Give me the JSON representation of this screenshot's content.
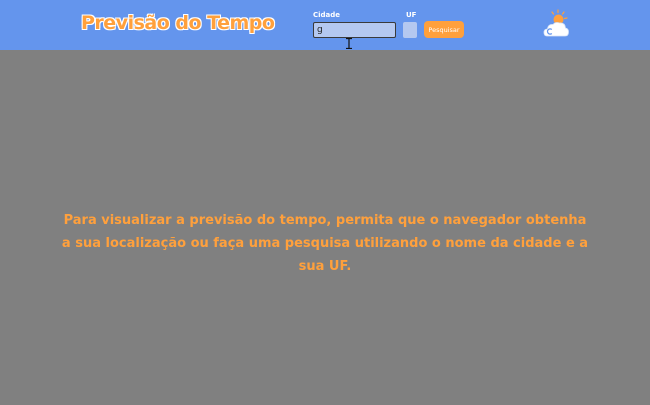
{
  "header": {
    "title": "Previsão do Tempo",
    "city_label": "Cidade",
    "city_value": "g",
    "uf_label": "UF",
    "uf_value": "",
    "search_button": "Pesquisar",
    "weather_icon": "cloud-sun-icon"
  },
  "message": "Para visualizar a previsão do tempo, permita que o navegador obtenha a sua localização ou faça uma pesquisa utilizando o nome da cidade e a sua UF.",
  "colors": {
    "header_background": "#6495ed",
    "page_background": "#808080",
    "accent": "#ffa03c",
    "input_background": "#b4c8f0"
  }
}
